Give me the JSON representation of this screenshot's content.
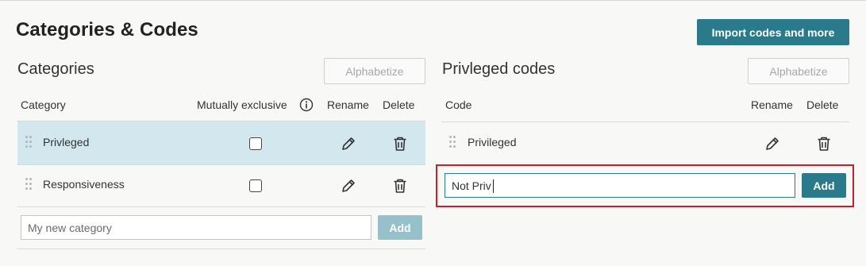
{
  "page": {
    "title": "Categories & Codes",
    "import_button": "Import codes and more"
  },
  "categories_panel": {
    "title": "Categories",
    "alphabetize_label": "Alphabetize",
    "columns": {
      "category": "Category",
      "mutually_exclusive": "Mutually exclusive",
      "rename": "Rename",
      "delete": "Delete"
    },
    "rows": [
      {
        "label": "Privleged",
        "mutually_exclusive": false,
        "selected": true
      },
      {
        "label": "Responsiveness",
        "mutually_exclusive": false,
        "selected": false
      }
    ],
    "new_input": {
      "placeholder": "My new category",
      "value": ""
    },
    "add_label": "Add"
  },
  "codes_panel": {
    "title": "Privleged codes",
    "alphabetize_label": "Alphabetize",
    "columns": {
      "code": "Code",
      "rename": "Rename",
      "delete": "Delete"
    },
    "rows": [
      {
        "label": "Privileged"
      }
    ],
    "new_input": {
      "placeholder": "",
      "value": "Not Priv"
    },
    "add_label": "Add"
  },
  "icons": {
    "rename": "pencil-icon",
    "delete": "trash-icon",
    "info": "info-icon",
    "drag": "drag-handle-icon"
  },
  "colors": {
    "accent": "#2b7a8b",
    "accent_disabled": "#96c1cb",
    "selected_row": "#d2e8ee",
    "highlight": "#c0242b",
    "background": "#f8f8f7"
  }
}
